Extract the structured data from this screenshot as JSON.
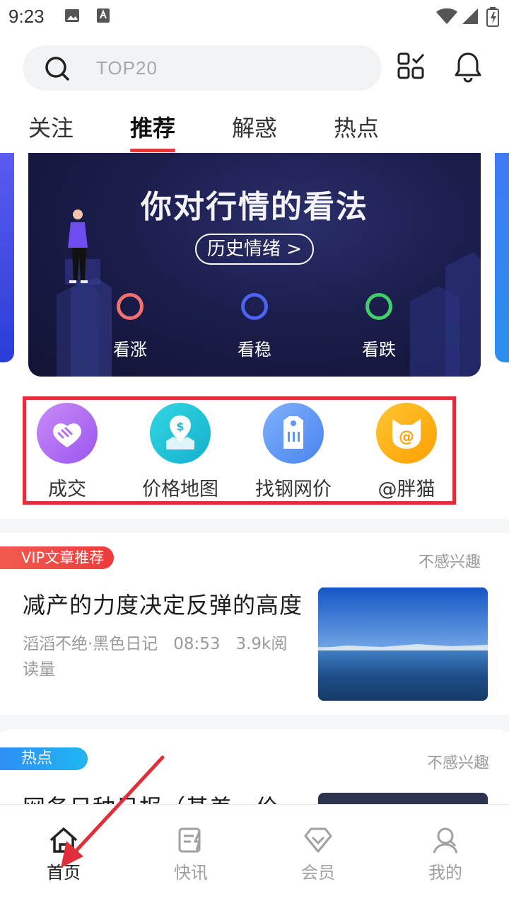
{
  "status_bar": {
    "time": "9:23"
  },
  "search": {
    "placeholder": "TOP20"
  },
  "tabs": [
    {
      "label": "关注"
    },
    {
      "label": "推荐",
      "active": true
    },
    {
      "label": "解惑"
    },
    {
      "label": "热点"
    }
  ],
  "banner": {
    "title": "你对行情的看法",
    "history_button": "历史情绪 >",
    "options": [
      {
        "label": "看涨",
        "color": "#f26f6f"
      },
      {
        "label": "看稳",
        "color": "#4a63f0"
      },
      {
        "label": "看跌",
        "color": "#3fcf68"
      }
    ]
  },
  "quick_menu": {
    "items": [
      {
        "label": "成交",
        "icon": "handshake-icon",
        "color": "#b46bf2"
      },
      {
        "label": "价格地图",
        "icon": "price-map-icon",
        "color": "#25c8d8"
      },
      {
        "label": "找钢网价",
        "icon": "price-tag-icon",
        "color": "#5b95f5"
      },
      {
        "label": "@胖猫",
        "icon": "cat-icon",
        "color": "#ffb300"
      }
    ]
  },
  "feed": {
    "card1": {
      "badge": "VIP文章推荐",
      "dismiss": "不感兴趣",
      "title": "减产的力度决定反弹的高度",
      "author": "滔滔不绝·黑色日记",
      "time": "08:53",
      "reads": "3.9k阅读量"
    },
    "card2": {
      "badge": "热点",
      "dismiss": "不感兴趣",
      "title": "网务日种日报（基差，价"
    }
  },
  "bottom_nav": [
    {
      "label": "首页",
      "icon": "home-icon",
      "active": true
    },
    {
      "label": "快讯",
      "icon": "news-flash-icon"
    },
    {
      "label": "会员",
      "icon": "vip-diamond-icon"
    },
    {
      "label": "我的",
      "icon": "user-icon"
    }
  ],
  "colors": {
    "accent": "#e53935",
    "annotation": "#e02f3a"
  }
}
